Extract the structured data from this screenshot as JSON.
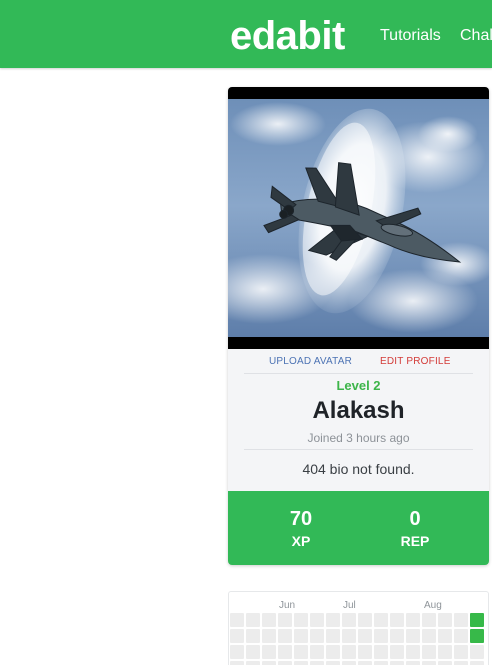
{
  "header": {
    "brand": "edabit",
    "nav": {
      "tutorials": "Tutorials",
      "challenges": "Challenges"
    },
    "background_color": "#32b957"
  },
  "profile": {
    "avatar_alt": "jet fighter breaking the sound barrier",
    "actions": {
      "upload_avatar": "UPLOAD AVATAR",
      "edit_profile": "EDIT PROFILE"
    },
    "level": "Level 2",
    "username": "Alakash",
    "joined": "Joined 3 hours ago",
    "bio": "404 bio not found.",
    "stats": {
      "xp": {
        "value": "70",
        "label": "XP"
      },
      "rep": {
        "value": "0",
        "label": "REP"
      }
    },
    "stats_color": "#32b957"
  },
  "activity": {
    "months": [
      "Jun",
      "Jul",
      "Aug"
    ],
    "recent_activity_days": 2,
    "cell_color": "#ececec",
    "active_cell_color": "#37b949"
  },
  "icons": {
    "avatar_image": "avatar-image"
  }
}
